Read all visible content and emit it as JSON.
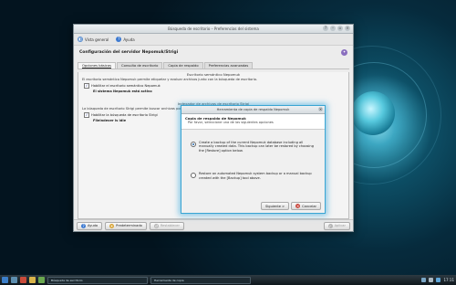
{
  "window": {
    "title": "Búsqueda de escritorio – Preferencias del sistema",
    "toolbar": {
      "overview_label": "Vista general",
      "help_label": "Ayuda"
    },
    "header": "Configuración del servidor Nepomuk/Strigi",
    "tabs": [
      {
        "label": "Opciones básicas",
        "active": true
      },
      {
        "label": "Consulta de escritorio",
        "active": false
      },
      {
        "label": "Copia de respaldo",
        "active": false
      },
      {
        "label": "Preferencias avanzadas",
        "active": false
      }
    ],
    "nepomuk": {
      "section_title": "Escritorio semántico Nepomuk",
      "description": "El escritorio semántico Nepomuk permite etiquetar y evaluar archivos junto con la búsqueda de escritorio.",
      "checkbox_label": "Habilitar el escritorio semántico Nepomuk",
      "status": "El sistema Nepomuk está activo"
    },
    "strigi": {
      "section_title": "Indexador de archivos de escritorio Strigi",
      "description": "La búsqueda de escritorio Strigi permite buscar archivos por contenido en vez de sólo por su nombre.",
      "checkbox_label": "Habilitar la búsqueda de escritorio Strigi",
      "status": "Fileindexer is idle"
    },
    "bottom": {
      "help_label": "Ayuda",
      "default_label": "Predeterminado",
      "reset_label": "Restablecer",
      "apply_label": "Aplicar"
    }
  },
  "dialog": {
    "title": "Herramienta de copia de respaldo Nepomuk",
    "heading": "Copia de respaldo de Nepomuk",
    "subheading": "Por favor, seleccione una de las siguientes opciones",
    "options": [
      {
        "text": "Create a backup of the current Nepomuk database including all manually created data. This backup can later be restored by choosing the [Restore] option below.",
        "selected": true
      },
      {
        "text": "Restore an automated Nepomuk system backup or a manual backup created with the [Backup] tool above.",
        "selected": false
      }
    ],
    "next_label": "Siguiente >",
    "cancel_label": "Cancelar"
  },
  "taskbar": {
    "tasks": [
      {
        "label": "Búsqueda de escritorio"
      },
      {
        "label": "Herramienta de copia"
      }
    ],
    "clock": "17:11"
  }
}
